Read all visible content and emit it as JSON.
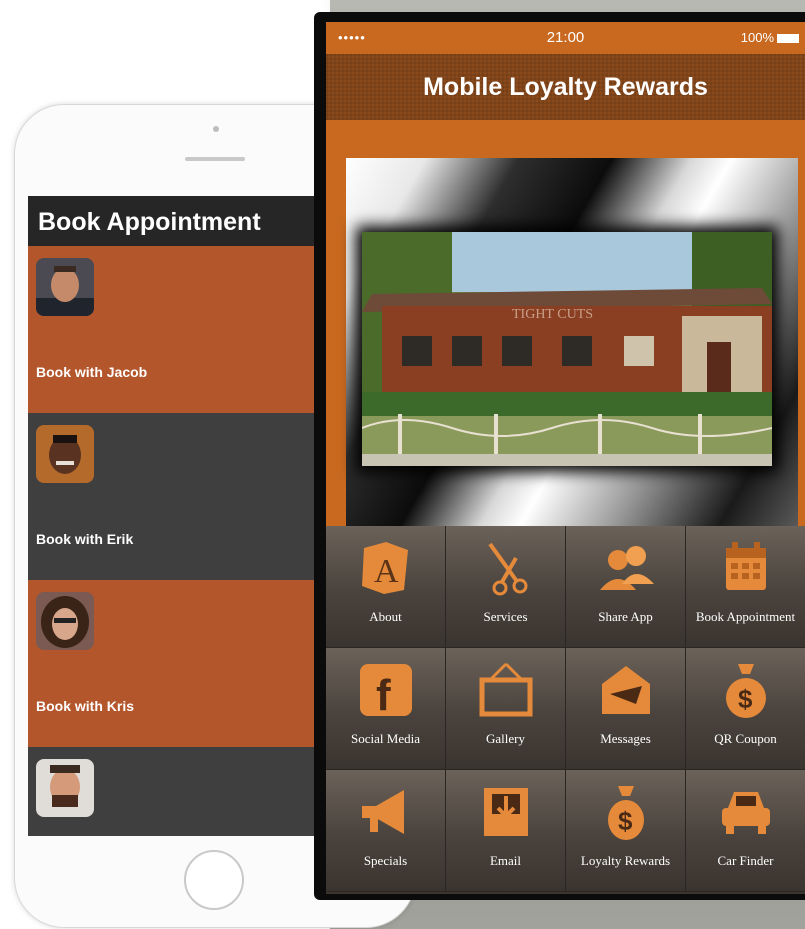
{
  "left_phone": {
    "header_title": "Book Appointment",
    "rows": [
      {
        "label": "Book with Jacob",
        "bg": "#b4562b"
      },
      {
        "label": "Book with Erik",
        "bg": "#3f3f3f"
      },
      {
        "label": "Book with Kris",
        "bg": "#b4562b"
      },
      {
        "label": "",
        "bg": "#3f3f3f"
      }
    ]
  },
  "right_phone": {
    "status": {
      "carrier": "•••••",
      "time": "21:00",
      "battery": "100%"
    },
    "title": "Mobile Loyalty Rewards",
    "photo_sign": "TIGHT CUTS",
    "tiles": [
      {
        "label": "About",
        "icon": "about-icon"
      },
      {
        "label": "Services",
        "icon": "scissors-icon"
      },
      {
        "label": "Share App",
        "icon": "share-users-icon"
      },
      {
        "label": "Book Appointment",
        "icon": "calendar-icon"
      },
      {
        "label": "Social Media",
        "icon": "facebook-icon"
      },
      {
        "label": "Gallery",
        "icon": "picture-frame-icon"
      },
      {
        "label": "Messages",
        "icon": "envelope-icon"
      },
      {
        "label": "QR Coupon",
        "icon": "money-bag-icon"
      },
      {
        "label": "Specials",
        "icon": "megaphone-icon"
      },
      {
        "label": "Email",
        "icon": "inbox-icon"
      },
      {
        "label": "Loyalty Rewards",
        "icon": "money-bag-icon"
      },
      {
        "label": "Car Finder",
        "icon": "car-icon"
      }
    ],
    "accent": "#c8691f"
  }
}
